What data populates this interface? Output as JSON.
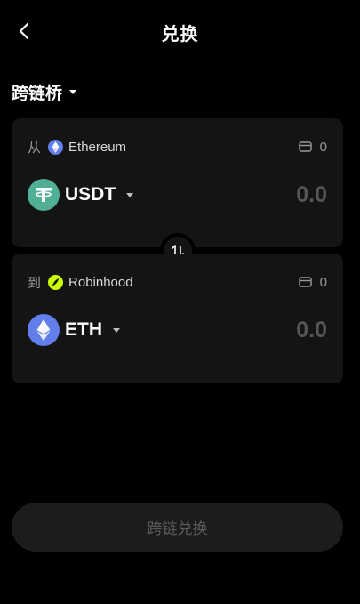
{
  "header": {
    "title": "兑换",
    "back_icon": "chevron-left-icon"
  },
  "mode": {
    "label": "跨链桥",
    "icon": "caret-down-icon"
  },
  "from": {
    "direction_label": "从",
    "chain_name": "Ethereum",
    "chain_icon": "ethereum-icon",
    "balance": "0",
    "wallet_icon": "wallet-icon",
    "token_symbol": "USDT",
    "token_icon": "tether-icon",
    "amount_placeholder": "0.0",
    "colors": {
      "token_bg": "#50AF95",
      "chain_bg": "#627EEA"
    }
  },
  "to": {
    "direction_label": "到",
    "chain_name": "Robinhood",
    "chain_icon": "robinhood-feather-icon",
    "balance": "0",
    "wallet_icon": "wallet-icon",
    "token_symbol": "ETH",
    "token_icon": "ethereum-icon",
    "amount_placeholder": "0.0",
    "colors": {
      "token_bg": "#627EEA",
      "chain_bg": "#CCFF00"
    }
  },
  "swap_toggle": {
    "icon": "swap-vertical-arrows-icon"
  },
  "submit": {
    "label": "跨链兑换",
    "disabled": true
  }
}
